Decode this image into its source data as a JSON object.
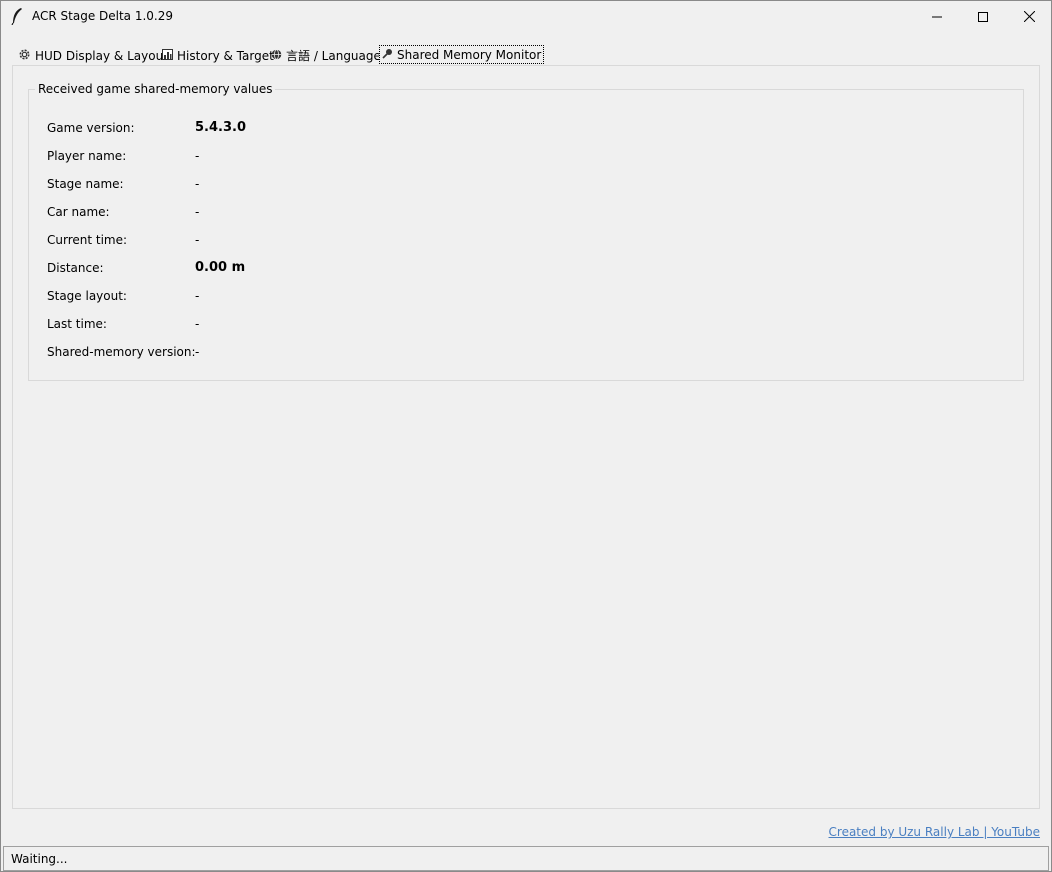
{
  "window": {
    "title": "ACR Stage Delta 1.0.29"
  },
  "tabs": [
    {
      "label": "HUD Display & Layout",
      "icon": "gear-icon"
    },
    {
      "label": "History & Target",
      "icon": "chart-icon"
    },
    {
      "label": "言語 / Language",
      "icon": "globe-icon"
    },
    {
      "label": "Shared Memory Monitor",
      "icon": "pin-icon"
    }
  ],
  "monitor": {
    "group_title": "Received game shared-memory values",
    "rows": [
      {
        "label": "Game version:",
        "value": "5.4.3.0"
      },
      {
        "label": "Player name:",
        "value": "-"
      },
      {
        "label": "Stage name:",
        "value": "-"
      },
      {
        "label": "Car name:",
        "value": "-"
      },
      {
        "label": "Current time:",
        "value": "-"
      },
      {
        "label": "Distance:",
        "value": "0.00 m"
      },
      {
        "label": "Stage layout:",
        "value": "-"
      },
      {
        "label": "Last time:",
        "value": "-"
      },
      {
        "label": "Shared-memory version:",
        "value": "-"
      }
    ]
  },
  "footer": {
    "link_text": "Created by Uzu Rally Lab  |  YouTube"
  },
  "status": {
    "text": "Waiting..."
  },
  "colors": {
    "background": "#f0f0f0",
    "link": "#4a7fc1"
  }
}
